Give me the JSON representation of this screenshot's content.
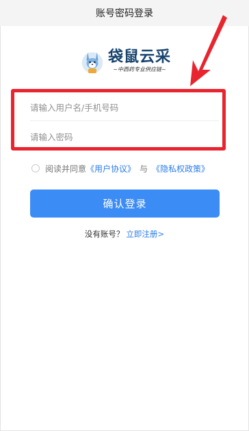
{
  "header": {
    "title": "账号密码登录"
  },
  "logo": {
    "brand_name": "袋鼠云采",
    "slogan": "~中西药专业供应链~",
    "mascot_icon": "kangaroo-mascot-icon"
  },
  "form": {
    "username_placeholder": "请输入用户名/手机号码",
    "password_placeholder": "请输入密码",
    "username_value": "",
    "password_value": ""
  },
  "agreement": {
    "prefix": "阅读并同意",
    "user_agreement": "《用户协议》",
    "conjunction": "与",
    "privacy_policy": "《隐私权政策》",
    "checked": false
  },
  "login_button": {
    "label": "确认登录"
  },
  "register": {
    "prompt": "没有账号？",
    "link": "立即注册>"
  },
  "colors": {
    "primary": "#3b8cf5",
    "link": "#2b7de9",
    "highlight": "#e8242e",
    "brand": "#16426d"
  }
}
